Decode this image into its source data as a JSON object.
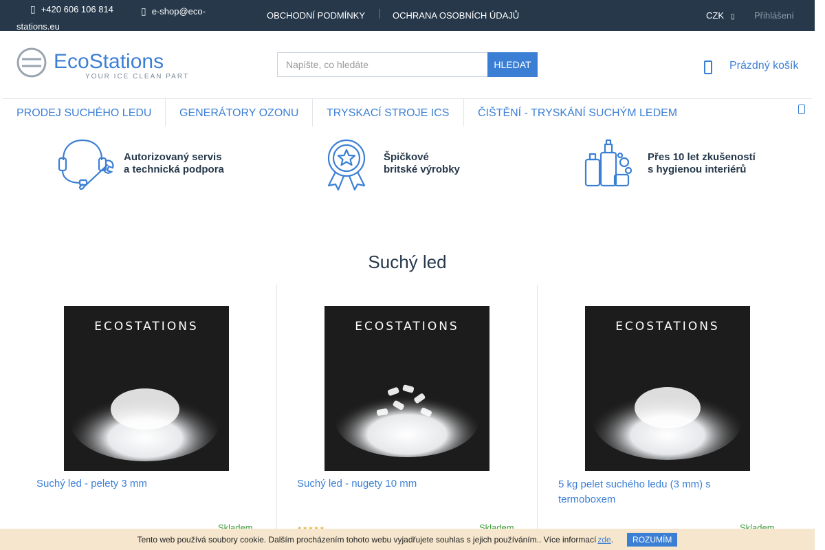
{
  "topbar": {
    "phone": "+420 606 106 814",
    "email": "e-shop@eco-stations.eu",
    "links": [
      "OBCHODNÍ PODMÍNKY",
      "OCHRANA OSOBNÍCH ÚDAJŮ"
    ],
    "currency": "CZK",
    "login": "Přihlášení"
  },
  "header": {
    "logo_main": "EcoStations",
    "logo_tagline": "YOUR ICE CLEAN PARTNER",
    "search_placeholder": "Napište, co hledáte",
    "search_button": "HLEDAT",
    "cart_label": "Prázdný košík"
  },
  "nav": {
    "items": [
      "PRODEJ SUCHÉHO LEDU",
      "GENERÁTORY OZONU",
      "TRYSKACÍ STROJE ICS",
      "ČIŠTĚNÍ - TRYSKÁNÍ SUCHÝM LEDEM"
    ]
  },
  "benefits": [
    {
      "line1": "Autorizovaný servis",
      "line2": "a technická podpora",
      "icon": "headset-wrench-icon"
    },
    {
      "line1": "Špičkové",
      "line2": "britské výrobky",
      "icon": "award-badge-icon"
    },
    {
      "line1": "Přes 10 let zkušeností",
      "line2": "s hygienou interiérů",
      "icon": "cleaning-bottles-icon"
    }
  ],
  "section": {
    "title": "Suchý led"
  },
  "products": [
    {
      "name": "Suchý led - pelety 3 mm",
      "stock": "Skladem",
      "image_label": "ECOSTATIONS",
      "variant": "pellets"
    },
    {
      "name": "Suchý led - nugety 10 mm",
      "stock": "Skladem",
      "image_label": "ECOSTATIONS",
      "variant": "nuggets"
    },
    {
      "name": "5 kg pelet suchého ledu (3 mm) s termoboxem",
      "stock": "Skladem",
      "image_label": "ECOSTATIONS",
      "variant": "pellets"
    }
  ],
  "cookie": {
    "text": "Tento web používá soubory cookie. Dalším procházením tohoto webu vyjadřujete souhlas s jejich používáním.. Více informací",
    "link": "zde",
    "button": "ROZUMÍM"
  },
  "colors": {
    "topbar": "#26384a",
    "accent": "#3b7fd5",
    "stock": "#3a9a3a",
    "cookie_bg": "#f5e6cd"
  }
}
